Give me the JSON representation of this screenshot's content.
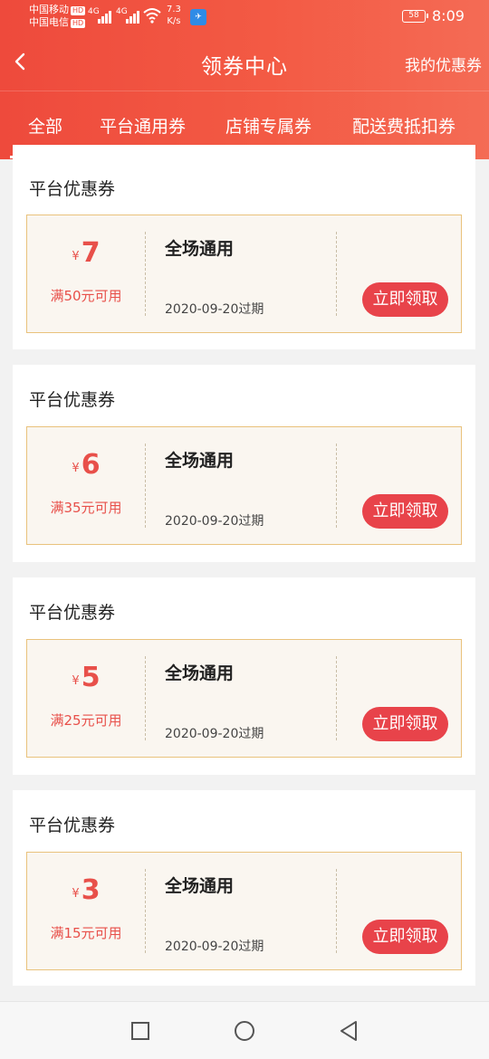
{
  "status_bar": {
    "carrier1": "中国移动",
    "carrier2": "中国电信",
    "hd": "HD",
    "network": "4G",
    "speed_value": "7.3",
    "speed_unit": "K/s",
    "battery": "58",
    "time": "8:09"
  },
  "header": {
    "title": "领券中心",
    "my_coupons": "我的优惠券"
  },
  "tabs": [
    {
      "label": "全部",
      "active": true
    },
    {
      "label": "平台通用券",
      "active": false
    },
    {
      "label": "店铺专属券",
      "active": false
    },
    {
      "label": "配送费抵扣券",
      "active": false
    }
  ],
  "coupons": [
    {
      "section_title": "平台优惠券",
      "currency": "¥",
      "amount": "7",
      "condition": "满50元可用",
      "scope": "全场通用",
      "expiry": "2020-09-20过期",
      "button": "立即领取"
    },
    {
      "section_title": "平台优惠券",
      "currency": "¥",
      "amount": "6",
      "condition": "满35元可用",
      "scope": "全场通用",
      "expiry": "2020-09-20过期",
      "button": "立即领取"
    },
    {
      "section_title": "平台优惠券",
      "currency": "¥",
      "amount": "5",
      "condition": "满25元可用",
      "scope": "全场通用",
      "expiry": "2020-09-20过期",
      "button": "立即领取"
    },
    {
      "section_title": "平台优惠券",
      "currency": "¥",
      "amount": "3",
      "condition": "满15元可用",
      "scope": "全场通用",
      "expiry": "2020-09-20过期",
      "button": "立即领取"
    }
  ],
  "colors": {
    "header_gradient_start": "#ee4a3c",
    "header_gradient_end": "#f46b55",
    "accent_red": "#e8434a",
    "coupon_background": "#faf6f0",
    "coupon_border": "#e9c27c"
  },
  "icons": {
    "back": "back-arrow-icon",
    "recents": "square-recents-icon",
    "home": "circle-home-icon",
    "nav_back": "triangle-back-icon"
  }
}
